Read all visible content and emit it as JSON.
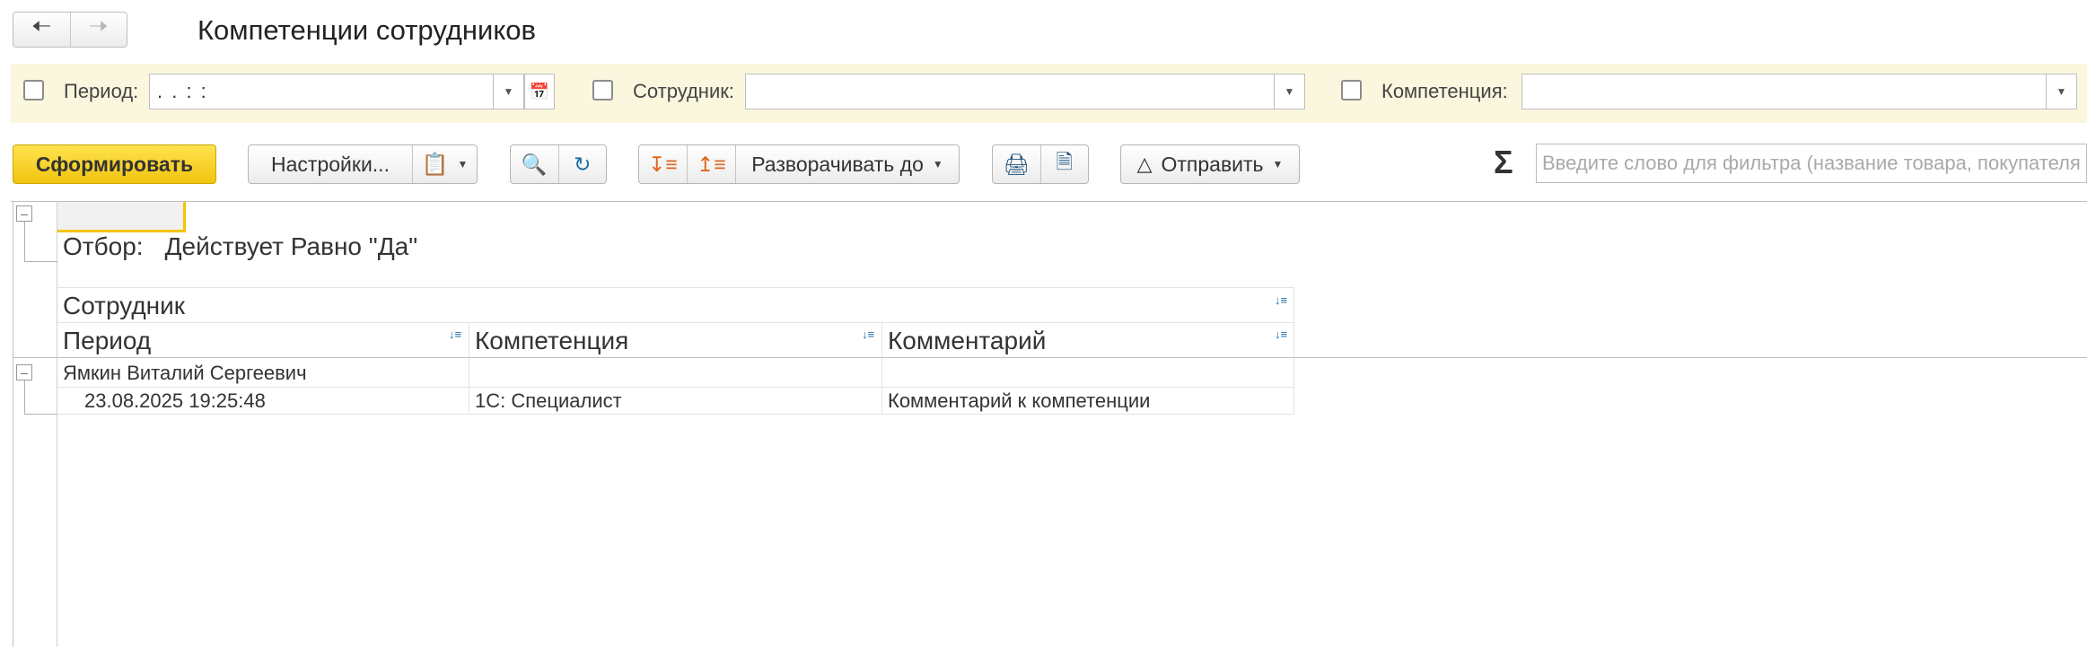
{
  "title": "Компетенции сотрудников",
  "nav": {
    "back_icon": "arrow-left-icon",
    "forward_icon": "arrow-right-icon"
  },
  "filters": {
    "period_label": "Период:",
    "period_value": " .  .       :  :",
    "employee_label": "Сотрудник:",
    "employee_value": "",
    "competence_label": "Компетенция:",
    "competence_value": ""
  },
  "toolbar": {
    "generate_label": "Сформировать",
    "settings_label": "Настройки...",
    "expand_label": "Разворачивать до",
    "send_label": "Отправить",
    "sigma": "Σ",
    "search_placeholder": "Введите слово для фильтра (название товара, покупателя и т.п.)"
  },
  "report": {
    "filter_caption": "Отбор:",
    "filter_value": "Действует Равно \"Да\"",
    "header_group": "Сотрудник",
    "columns": [
      "Период",
      "Компетенция",
      "Комментарий"
    ],
    "group_row": "Ямкин Виталий Сергеевич",
    "rows": [
      {
        "period": "23.08.2025 19:25:48",
        "competence": "1С: Специалист",
        "comment": "Комментарий к компетенции"
      }
    ]
  },
  "colors": {
    "filter_bg": "#fbf7de",
    "primary_btn": "#f5c400",
    "sort_icon": "#1b6ea8"
  }
}
